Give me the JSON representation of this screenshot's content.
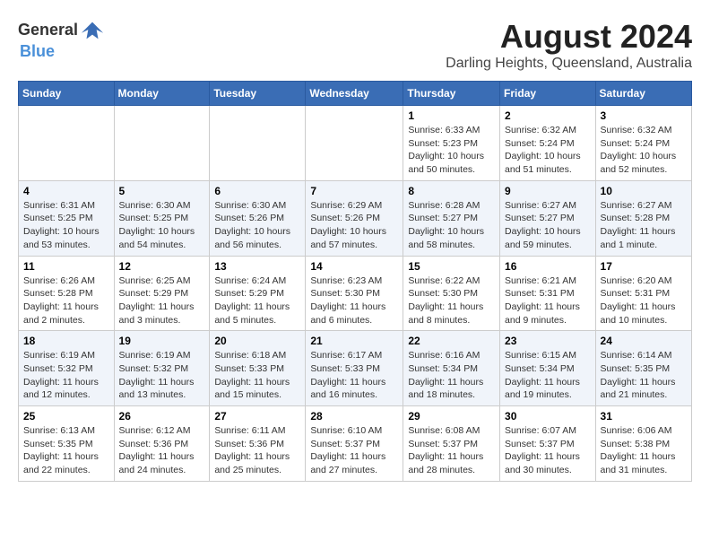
{
  "header": {
    "logo_general": "General",
    "logo_blue": "Blue",
    "month_year": "August 2024",
    "location": "Darling Heights, Queensland, Australia"
  },
  "weekdays": [
    "Sunday",
    "Monday",
    "Tuesday",
    "Wednesday",
    "Thursday",
    "Friday",
    "Saturday"
  ],
  "weeks": [
    [
      {
        "day": "",
        "info": ""
      },
      {
        "day": "",
        "info": ""
      },
      {
        "day": "",
        "info": ""
      },
      {
        "day": "",
        "info": ""
      },
      {
        "day": "1",
        "info": "Sunrise: 6:33 AM\nSunset: 5:23 PM\nDaylight: 10 hours\nand 50 minutes."
      },
      {
        "day": "2",
        "info": "Sunrise: 6:32 AM\nSunset: 5:24 PM\nDaylight: 10 hours\nand 51 minutes."
      },
      {
        "day": "3",
        "info": "Sunrise: 6:32 AM\nSunset: 5:24 PM\nDaylight: 10 hours\nand 52 minutes."
      }
    ],
    [
      {
        "day": "4",
        "info": "Sunrise: 6:31 AM\nSunset: 5:25 PM\nDaylight: 10 hours\nand 53 minutes."
      },
      {
        "day": "5",
        "info": "Sunrise: 6:30 AM\nSunset: 5:25 PM\nDaylight: 10 hours\nand 54 minutes."
      },
      {
        "day": "6",
        "info": "Sunrise: 6:30 AM\nSunset: 5:26 PM\nDaylight: 10 hours\nand 56 minutes."
      },
      {
        "day": "7",
        "info": "Sunrise: 6:29 AM\nSunset: 5:26 PM\nDaylight: 10 hours\nand 57 minutes."
      },
      {
        "day": "8",
        "info": "Sunrise: 6:28 AM\nSunset: 5:27 PM\nDaylight: 10 hours\nand 58 minutes."
      },
      {
        "day": "9",
        "info": "Sunrise: 6:27 AM\nSunset: 5:27 PM\nDaylight: 10 hours\nand 59 minutes."
      },
      {
        "day": "10",
        "info": "Sunrise: 6:27 AM\nSunset: 5:28 PM\nDaylight: 11 hours\nand 1 minute."
      }
    ],
    [
      {
        "day": "11",
        "info": "Sunrise: 6:26 AM\nSunset: 5:28 PM\nDaylight: 11 hours\nand 2 minutes."
      },
      {
        "day": "12",
        "info": "Sunrise: 6:25 AM\nSunset: 5:29 PM\nDaylight: 11 hours\nand 3 minutes."
      },
      {
        "day": "13",
        "info": "Sunrise: 6:24 AM\nSunset: 5:29 PM\nDaylight: 11 hours\nand 5 minutes."
      },
      {
        "day": "14",
        "info": "Sunrise: 6:23 AM\nSunset: 5:30 PM\nDaylight: 11 hours\nand 6 minutes."
      },
      {
        "day": "15",
        "info": "Sunrise: 6:22 AM\nSunset: 5:30 PM\nDaylight: 11 hours\nand 8 minutes."
      },
      {
        "day": "16",
        "info": "Sunrise: 6:21 AM\nSunset: 5:31 PM\nDaylight: 11 hours\nand 9 minutes."
      },
      {
        "day": "17",
        "info": "Sunrise: 6:20 AM\nSunset: 5:31 PM\nDaylight: 11 hours\nand 10 minutes."
      }
    ],
    [
      {
        "day": "18",
        "info": "Sunrise: 6:19 AM\nSunset: 5:32 PM\nDaylight: 11 hours\nand 12 minutes."
      },
      {
        "day": "19",
        "info": "Sunrise: 6:19 AM\nSunset: 5:32 PM\nDaylight: 11 hours\nand 13 minutes."
      },
      {
        "day": "20",
        "info": "Sunrise: 6:18 AM\nSunset: 5:33 PM\nDaylight: 11 hours\nand 15 minutes."
      },
      {
        "day": "21",
        "info": "Sunrise: 6:17 AM\nSunset: 5:33 PM\nDaylight: 11 hours\nand 16 minutes."
      },
      {
        "day": "22",
        "info": "Sunrise: 6:16 AM\nSunset: 5:34 PM\nDaylight: 11 hours\nand 18 minutes."
      },
      {
        "day": "23",
        "info": "Sunrise: 6:15 AM\nSunset: 5:34 PM\nDaylight: 11 hours\nand 19 minutes."
      },
      {
        "day": "24",
        "info": "Sunrise: 6:14 AM\nSunset: 5:35 PM\nDaylight: 11 hours\nand 21 minutes."
      }
    ],
    [
      {
        "day": "25",
        "info": "Sunrise: 6:13 AM\nSunset: 5:35 PM\nDaylight: 11 hours\nand 22 minutes."
      },
      {
        "day": "26",
        "info": "Sunrise: 6:12 AM\nSunset: 5:36 PM\nDaylight: 11 hours\nand 24 minutes."
      },
      {
        "day": "27",
        "info": "Sunrise: 6:11 AM\nSunset: 5:36 PM\nDaylight: 11 hours\nand 25 minutes."
      },
      {
        "day": "28",
        "info": "Sunrise: 6:10 AM\nSunset: 5:37 PM\nDaylight: 11 hours\nand 27 minutes."
      },
      {
        "day": "29",
        "info": "Sunrise: 6:08 AM\nSunset: 5:37 PM\nDaylight: 11 hours\nand 28 minutes."
      },
      {
        "day": "30",
        "info": "Sunrise: 6:07 AM\nSunset: 5:37 PM\nDaylight: 11 hours\nand 30 minutes."
      },
      {
        "day": "31",
        "info": "Sunrise: 6:06 AM\nSunset: 5:38 PM\nDaylight: 11 hours\nand 31 minutes."
      }
    ]
  ]
}
